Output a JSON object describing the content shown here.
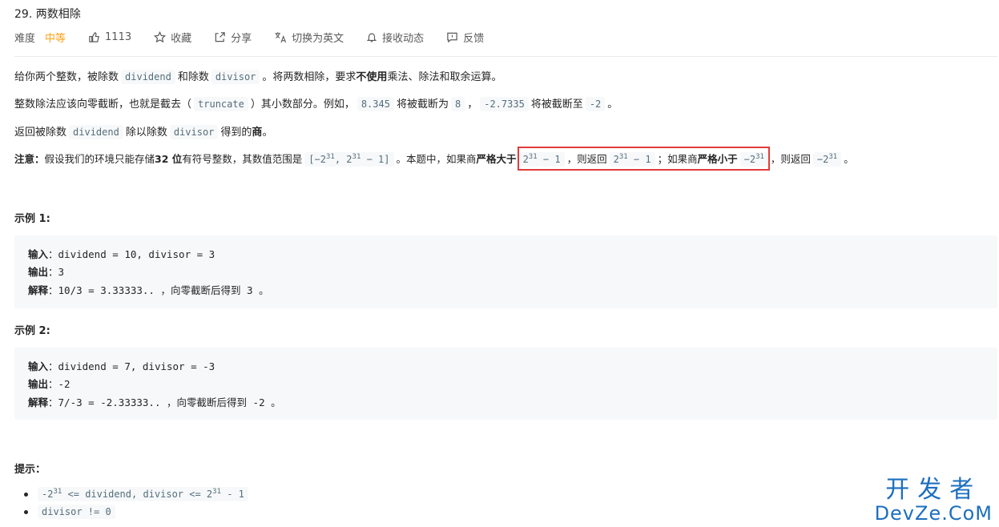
{
  "header": {
    "title": "29. 两数相除",
    "difficulty_label": "难度",
    "difficulty_value": "中等",
    "likes": "1113",
    "collect": "收藏",
    "share": "分享",
    "switch_lang": "切换为英文",
    "subscribe": "接收动态",
    "feedback": "反馈"
  },
  "description": {
    "p1": [
      "给你两个整数，被除数",
      "dividend",
      "和除数",
      "divisor",
      "。将两数相除，要求",
      "不使用",
      "乘法、除法和取余运算。"
    ],
    "p2": [
      "整数除法应该向零截断，也就是截去（",
      "truncate",
      "）其小数部分。例如，",
      "8.345",
      "将被截断为",
      "8",
      "，",
      "-2.7335",
      "将被截断至",
      "-2",
      "。"
    ],
    "p3": [
      "返回被除数",
      "dividend",
      "除以除数",
      "divisor",
      "得到的",
      "商",
      "。"
    ],
    "p4": {
      "note_label": "注意：",
      "t1": "假设我们的环境只能存储",
      "bits": "32 位",
      "t2": "有符号整数，其数值范围是",
      "range_a": "[−2",
      "exp": "31",
      "range_b": ",",
      "range_c": "2",
      "range_d": "− 1]",
      "t3": "。本题中，",
      "t4": "如果商",
      "strict_gt": "严格大于",
      "val_a": "2",
      "val_b": "− 1",
      "t5": "，则返回",
      "t6": "；如果商",
      "strict_lt": "严格小于",
      "neg": "−2",
      "t7": "，则返回",
      "t8": "。"
    }
  },
  "example1": {
    "heading": "示例 1:",
    "input_label": "输入",
    "input": "dividend = 10, divisor = 3",
    "output_label": "输出",
    "output": "3",
    "explain_label": "解释",
    "explain_a": "10/3 = 3.33333..",
    "explain_b": "，向零截断后得到",
    "explain_c": "3",
    "explain_d": "。"
  },
  "example2": {
    "heading": "示例 2:",
    "input_label": "输入",
    "input": "dividend = 7, divisor = -3",
    "output_label": "输出",
    "output": "-2",
    "explain_label": "解释",
    "explain_a": "7/-3 = -2.33333..",
    "explain_b": "，向零截断后得到",
    "explain_c": "-2",
    "explain_d": "。"
  },
  "hints": {
    "heading": "提示：",
    "h1_a": "-2",
    "h1_exp": "31",
    "h1_b": "<= dividend, divisor <= 2",
    "h1_c": "- 1",
    "h2": "divisor != 0"
  },
  "watermark": {
    "cn": "开发者",
    "en": "DevZe.CoM"
  },
  "colors": {
    "accent": "#ffa116",
    "highlight_border": "#e23b3b",
    "watermark": "#1d6fbf"
  }
}
